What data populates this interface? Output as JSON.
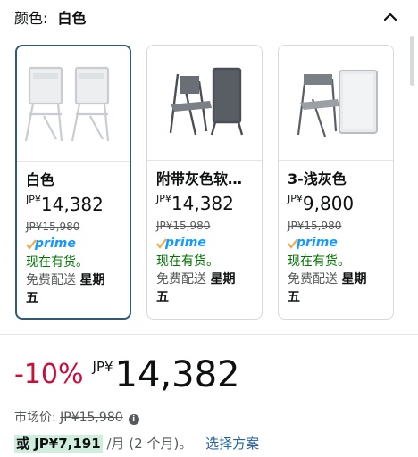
{
  "header": {
    "label": "颜色:",
    "value": "白色"
  },
  "cards": [
    {
      "title": "白色",
      "price_symbol": "JP¥",
      "price": "14,382",
      "old_price": "JP¥15,980",
      "prime": "prime",
      "stock": "现在有货。",
      "ship_line1": "免费配送",
      "ship_day_a": "星期",
      "ship_day_b": "五",
      "selected": true
    },
    {
      "title": "附带灰色软…",
      "price_symbol": "JP¥",
      "price": "14,382",
      "old_price": "JP¥15,980",
      "prime": "prime",
      "stock": "现在有货。",
      "ship_line1": "免费配送",
      "ship_day_a": "星期",
      "ship_day_b": "五",
      "selected": false
    },
    {
      "title": "3-浅灰色",
      "price_symbol": "JP¥",
      "price": "9,800",
      "old_price": "JP¥15,980",
      "prime": "prime",
      "stock": "现在有货。",
      "ship_line1": "免费配送",
      "ship_day_a": "星期",
      "ship_day_b": "五",
      "selected": false
    }
  ],
  "summary": {
    "discount": "-10%",
    "price_symbol": "JP¥",
    "price": "14,382",
    "market_label": "市场价:",
    "market_price": "JP¥15,980",
    "installment_prefix": "或 JP¥7,191",
    "installment_suffix": "/月 (2 个月)。",
    "plan_link": "选择方案"
  },
  "colors": {
    "selected_border": "#2f5a78",
    "discount": "#cc0c39",
    "stock": "#007600",
    "prime": "#1399ff",
    "link": "#2162a1",
    "installment_bg": "#cfeedd"
  },
  "icons": {
    "collapse": "chevron-up-icon",
    "info": "info-icon",
    "prime_check": "prime-check-icon"
  }
}
